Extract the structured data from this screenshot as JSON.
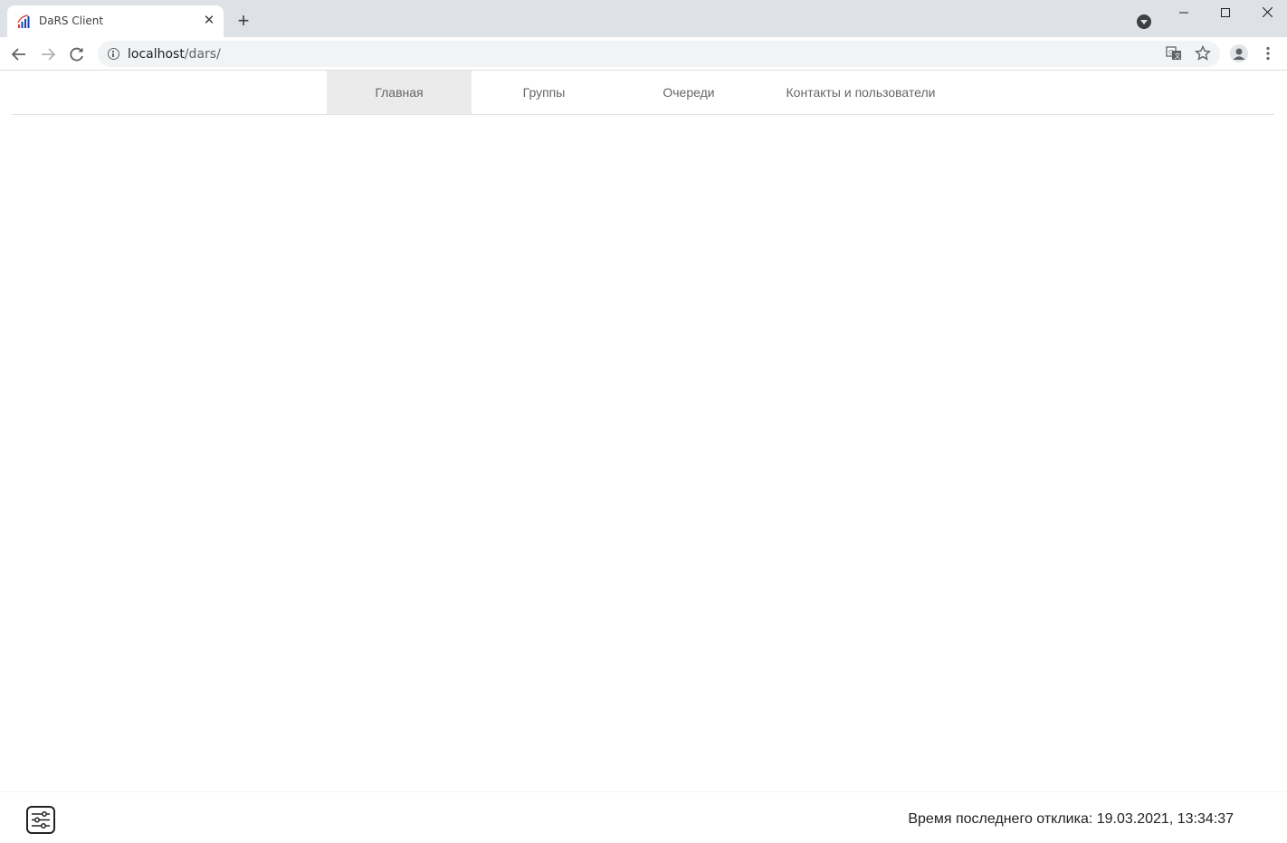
{
  "browser": {
    "tab_title": "DaRS Client",
    "tab_close_glyph": "✕",
    "new_tab_glyph": "+",
    "url_host": "localhost",
    "url_path": "/dars/",
    "window_controls": {
      "minimize": "—",
      "maximize": "☐",
      "close": "✕"
    }
  },
  "nav": {
    "items": [
      {
        "label": "Главная",
        "active": true
      },
      {
        "label": "Группы",
        "active": false
      },
      {
        "label": "Очереди",
        "active": false
      },
      {
        "label": "Контакты и пользователи",
        "active": false
      }
    ]
  },
  "footer": {
    "status_text": "Время последнего отклика: 19.03.2021, 13:34:37"
  },
  "icons": {
    "favicon": "signal-bars-icon",
    "settings": "sliders-icon"
  },
  "colors": {
    "tab_strip_bg": "#dee1e6",
    "active_nav_bg": "#ebebeb",
    "favicon_red": "#d33",
    "favicon_blue": "#1a3fb0"
  }
}
